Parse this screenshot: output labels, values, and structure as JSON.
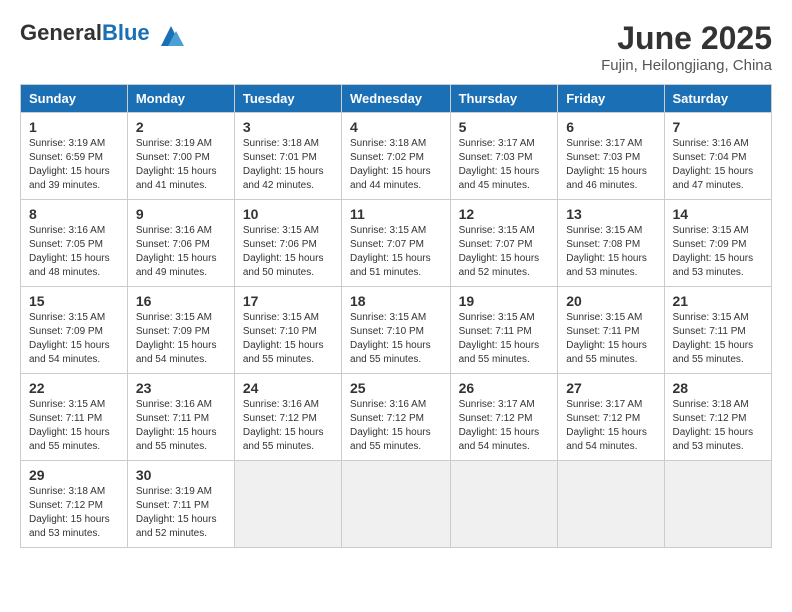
{
  "header": {
    "logo_general": "General",
    "logo_blue": "Blue",
    "month": "June 2025",
    "location": "Fujin, Heilongjiang, China"
  },
  "weekdays": [
    "Sunday",
    "Monday",
    "Tuesday",
    "Wednesday",
    "Thursday",
    "Friday",
    "Saturday"
  ],
  "days": [
    null,
    null,
    null,
    null,
    null,
    {
      "num": "1",
      "sunrise": "3:19 AM",
      "sunset": "6:59 PM",
      "daylight": "15 hours and 39 minutes."
    },
    {
      "num": "2",
      "sunrise": "3:19 AM",
      "sunset": "7:00 PM",
      "daylight": "15 hours and 41 minutes."
    },
    {
      "num": "3",
      "sunrise": "3:18 AM",
      "sunset": "7:01 PM",
      "daylight": "15 hours and 42 minutes."
    },
    {
      "num": "4",
      "sunrise": "3:18 AM",
      "sunset": "7:02 PM",
      "daylight": "15 hours and 44 minutes."
    },
    {
      "num": "5",
      "sunrise": "3:17 AM",
      "sunset": "7:03 PM",
      "daylight": "15 hours and 45 minutes."
    },
    {
      "num": "6",
      "sunrise": "3:17 AM",
      "sunset": "7:03 PM",
      "daylight": "15 hours and 46 minutes."
    },
    {
      "num": "7",
      "sunrise": "3:16 AM",
      "sunset": "7:04 PM",
      "daylight": "15 hours and 47 minutes."
    },
    {
      "num": "8",
      "sunrise": "3:16 AM",
      "sunset": "7:05 PM",
      "daylight": "15 hours and 48 minutes."
    },
    {
      "num": "9",
      "sunrise": "3:16 AM",
      "sunset": "7:06 PM",
      "daylight": "15 hours and 49 minutes."
    },
    {
      "num": "10",
      "sunrise": "3:15 AM",
      "sunset": "7:06 PM",
      "daylight": "15 hours and 50 minutes."
    },
    {
      "num": "11",
      "sunrise": "3:15 AM",
      "sunset": "7:07 PM",
      "daylight": "15 hours and 51 minutes."
    },
    {
      "num": "12",
      "sunrise": "3:15 AM",
      "sunset": "7:07 PM",
      "daylight": "15 hours and 52 minutes."
    },
    {
      "num": "13",
      "sunrise": "3:15 AM",
      "sunset": "7:08 PM",
      "daylight": "15 hours and 53 minutes."
    },
    {
      "num": "14",
      "sunrise": "3:15 AM",
      "sunset": "7:09 PM",
      "daylight": "15 hours and 53 minutes."
    },
    {
      "num": "15",
      "sunrise": "3:15 AM",
      "sunset": "7:09 PM",
      "daylight": "15 hours and 54 minutes."
    },
    {
      "num": "16",
      "sunrise": "3:15 AM",
      "sunset": "7:09 PM",
      "daylight": "15 hours and 54 minutes."
    },
    {
      "num": "17",
      "sunrise": "3:15 AM",
      "sunset": "7:10 PM",
      "daylight": "15 hours and 55 minutes."
    },
    {
      "num": "18",
      "sunrise": "3:15 AM",
      "sunset": "7:10 PM",
      "daylight": "15 hours and 55 minutes."
    },
    {
      "num": "19",
      "sunrise": "3:15 AM",
      "sunset": "7:11 PM",
      "daylight": "15 hours and 55 minutes."
    },
    {
      "num": "20",
      "sunrise": "3:15 AM",
      "sunset": "7:11 PM",
      "daylight": "15 hours and 55 minutes."
    },
    {
      "num": "21",
      "sunrise": "3:15 AM",
      "sunset": "7:11 PM",
      "daylight": "15 hours and 55 minutes."
    },
    {
      "num": "22",
      "sunrise": "3:15 AM",
      "sunset": "7:11 PM",
      "daylight": "15 hours and 55 minutes."
    },
    {
      "num": "23",
      "sunrise": "3:16 AM",
      "sunset": "7:11 PM",
      "daylight": "15 hours and 55 minutes."
    },
    {
      "num": "24",
      "sunrise": "3:16 AM",
      "sunset": "7:12 PM",
      "daylight": "15 hours and 55 minutes."
    },
    {
      "num": "25",
      "sunrise": "3:16 AM",
      "sunset": "7:12 PM",
      "daylight": "15 hours and 55 minutes."
    },
    {
      "num": "26",
      "sunrise": "3:17 AM",
      "sunset": "7:12 PM",
      "daylight": "15 hours and 54 minutes."
    },
    {
      "num": "27",
      "sunrise": "3:17 AM",
      "sunset": "7:12 PM",
      "daylight": "15 hours and 54 minutes."
    },
    {
      "num": "28",
      "sunrise": "3:18 AM",
      "sunset": "7:12 PM",
      "daylight": "15 hours and 53 minutes."
    },
    {
      "num": "29",
      "sunrise": "3:18 AM",
      "sunset": "7:12 PM",
      "daylight": "15 hours and 53 minutes."
    },
    {
      "num": "30",
      "sunrise": "3:19 AM",
      "sunset": "7:11 PM",
      "daylight": "15 hours and 52 minutes."
    }
  ]
}
